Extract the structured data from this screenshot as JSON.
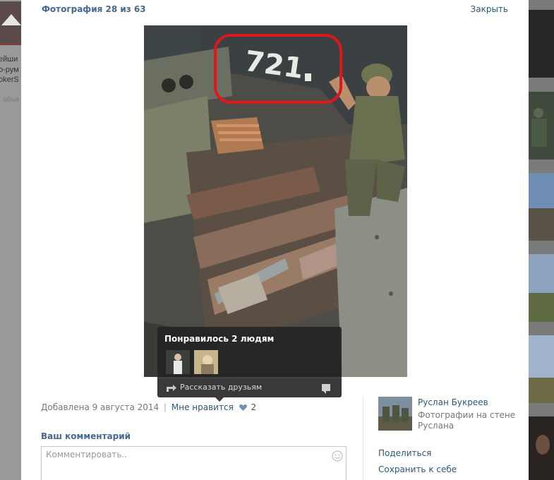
{
  "viewer": {
    "counter": "Фотография 28 из 63",
    "close_label": "Закрыть"
  },
  "photo": {
    "vehicle_number": "721"
  },
  "likes_popup": {
    "title": "Понравилось 2 людям",
    "share_label": "Рассказать друзьям"
  },
  "meta": {
    "added": "Добавлена 9 августа 2014",
    "separator": "|",
    "like_label": "Мне нравится",
    "like_count": "2"
  },
  "comment": {
    "heading": "Ваш комментарий",
    "placeholder": "Комментировать.."
  },
  "owner": {
    "name": "Руслан Букреев",
    "album": "Фотографии на стене Руслана"
  },
  "actions": {
    "share": "Поделиться",
    "save": "Сохранить к себе"
  },
  "background": {
    "left_texts": [
      "ейши",
      "о-рум",
      "okerS",
      "объя"
    ]
  },
  "colors": {
    "link": "#2b587a",
    "heading": "#45688e",
    "heart": "#6d8fb3",
    "highlight_circle": "#e0161b"
  }
}
